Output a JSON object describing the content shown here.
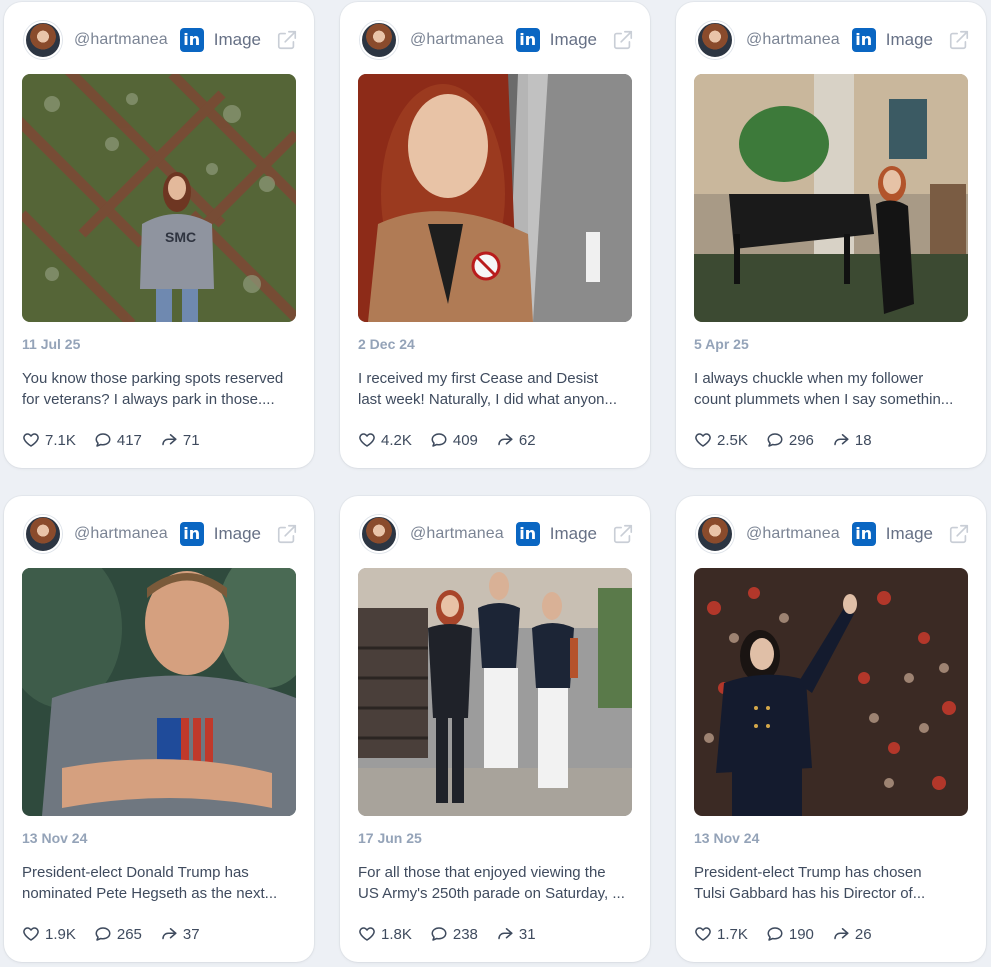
{
  "feed": {
    "posts": [
      {
        "handle": "@hartmanea",
        "platform": "linkedin",
        "content_type": "Image",
        "date": "11 Jul 25",
        "caption_line1": "You know those parking spots reserved",
        "caption_line2": "for veterans? I always park in those....",
        "likes": "7.1K",
        "comments": "417",
        "shares": "71",
        "image": {
          "type": "woman in grey sweatshirt in front of flower wall",
          "palette": [
            "#5b6b3a",
            "#7b4a35",
            "#2f3d2c",
            "#8f949f",
            "#6f89b0"
          ]
        }
      },
      {
        "handle": "@hartmanea",
        "platform": "linkedin",
        "content_type": "Image",
        "date": "2 Dec 24",
        "caption_line1": "I received my first Cease and Desist",
        "caption_line2": "last week! Naturally, I did what anyon...",
        "likes": "4.2K",
        "comments": "409",
        "shares": "62",
        "image": {
          "type": "woman with red hair selfie in elevator",
          "palette": [
            "#8d2b18",
            "#b07b55",
            "#c9a283",
            "#3a3a3a",
            "#8b8b8b"
          ]
        }
      },
      {
        "handle": "@hartmanea",
        "platform": "linkedin",
        "content_type": "Image",
        "date": "5 Apr 25",
        "caption_line1": "I always chuckle when my follower",
        "caption_line2": "count plummets when I say somethin...",
        "likes": "2.5K",
        "comments": "296",
        "shares": "18",
        "image": {
          "type": "woman in black dress seated by grand piano",
          "palette": [
            "#1a1a1a",
            "#3d7a3a",
            "#d0b597",
            "#3c4a32",
            "#a7a7a7"
          ]
        }
      },
      {
        "handle": "@hartmanea",
        "platform": "linkedin",
        "content_type": "Image",
        "date": "13 Nov 24",
        "caption_line1": "President-elect Donald Trump has",
        "caption_line2": "nominated Pete Hegseth as the next...",
        "likes": "1.9K",
        "comments": "265",
        "shares": "37",
        "image": {
          "type": "man in grey t-shirt with flag print, arms crossed",
          "palette": [
            "#2f4a3d",
            "#6f7780",
            "#d5a07f",
            "#1f4b9a",
            "#c0392b"
          ]
        }
      },
      {
        "handle": "@hartmanea",
        "platform": "linkedin",
        "content_type": "Image",
        "date": "17 Jun 25",
        "caption_line1": "For all those that enjoyed viewing the",
        "caption_line2": "US Army's 250th parade on Saturday, ...",
        "likes": "1.8K",
        "comments": "238",
        "shares": "31",
        "image": {
          "type": "three women, two in marine dress uniforms",
          "palette": [
            "#1c2536",
            "#f2f2f2",
            "#b5522b",
            "#9c9c9c",
            "#4a3f3a"
          ]
        }
      },
      {
        "handle": "@hartmanea",
        "platform": "linkedin",
        "content_type": "Image",
        "date": "13 Nov 24",
        "caption_line1": "President-elect Trump has chosen",
        "caption_line2": "Tulsi Gabbard has his Director of...",
        "likes": "1.7K",
        "comments": "190",
        "shares": "26",
        "image": {
          "type": "woman in navy suit waving on stage before crowd",
          "palette": [
            "#141b2e",
            "#c83a2c",
            "#e0bfa7",
            "#2b3f72",
            "#3b2a24"
          ]
        }
      }
    ]
  },
  "colors": {
    "background": "#edf0f5",
    "card": "#ffffff",
    "linkedin": "#0a66c2",
    "muted_text": "#94a3b8",
    "body_text": "#3f4b5e"
  },
  "icons": {
    "platform": "linkedin-icon",
    "open": "external-link-icon",
    "like": "heart-icon",
    "comment": "comment-icon",
    "share": "share-icon"
  }
}
